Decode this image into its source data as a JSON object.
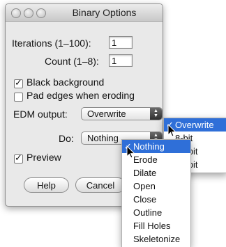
{
  "window": {
    "title": "Binary Options"
  },
  "fields": {
    "iterations": {
      "label": "Iterations (1–100):",
      "value": "1"
    },
    "count": {
      "label": "Count (1–8):",
      "value": "1"
    }
  },
  "checkboxes": {
    "black_background": {
      "label": "Black background",
      "checked": true
    },
    "pad_edges": {
      "label": "Pad edges when eroding",
      "checked": false
    },
    "preview": {
      "label": "Preview",
      "checked": true
    }
  },
  "edm": {
    "label": "EDM output:",
    "value": "Overwrite"
  },
  "do": {
    "label": "Do:",
    "value": "Nothing"
  },
  "buttons": {
    "help": "Help",
    "cancel": "Cancel"
  },
  "check_glyph": "✓",
  "edm_menu": {
    "items": [
      "Overwrite",
      "8-bit",
      "16-bit",
      "32-bit"
    ],
    "selected": "Overwrite"
  },
  "do_menu": {
    "items": [
      "Nothing",
      "Erode",
      "Dilate",
      "Open",
      "Close",
      "Outline",
      "Fill Holes",
      "Skeletonize"
    ],
    "selected": "Nothing"
  }
}
